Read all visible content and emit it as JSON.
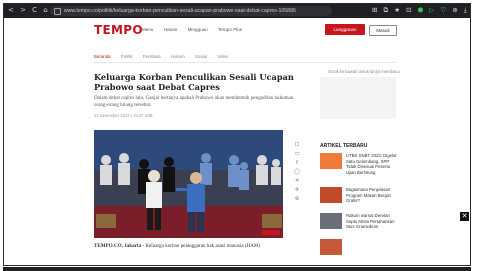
{
  "browser": {
    "nav_icons": "< > C ⌂",
    "url": "www.tempo.co/politik/keluarga-korban-penculikan-sesali-ucapan-prabowe-saat-debat-capres-105886",
    "ext_icons": "⊞ ⧉ ★ ⊡",
    "ext_green": "⬢ ▷",
    "ext_tail": "♡ ⊕ ⤓ ≡"
  },
  "site": {
    "logo": "TEMPO",
    "nav": [
      "Menu",
      "Harian",
      "Mingguan",
      "Tempo Plus"
    ],
    "subscribe": "Langganan",
    "login": "Masuk",
    "subnav": [
      "Beranda",
      "Politik",
      "Peristiwa",
      "Hukum",
      "Sosial",
      "Video"
    ]
  },
  "article": {
    "title": "Keluarga Korban Penculikan Sesali Ucapan Prabowo saat Debat Capres",
    "lead": "Dalam debat capres lalu, Ganjar bertanya apakah Prabowo akan membentuk pengadilan hukuman orang-orang hilang tersebut.",
    "date": "13 Desember 2023 | 15:47 WIB",
    "body_prefix": "TEMPO.CO, Jakarta",
    "body_rest": " - Keluarga korban pelanggaran hak asasi manusia (HAM)"
  },
  "sidebar": {
    "ad_line": "Scroll ke bawah untuk lanjut membaca",
    "heading": "ARTIKEL TERBARU",
    "items": [
      {
        "text": "UTBK SNBT 2023: Digelar Satu Gelombang, SPP Tidak Disesuai Peserta Ujian Berhitung",
        "color": "#f07a3a"
      },
      {
        "text": "Bagaimana Penjelasan Program Makan Bergizi Gratis?",
        "color": "#c04a2a"
      },
      {
        "text": "Rakum warnai Deretan Saptu Minta Pertahankan Stus Gramedium",
        "color": "#6b6f7a"
      },
      {
        "text": "Kampanye Akbar Terakhir Paslon",
        "color": "#c45a3a"
      }
    ]
  },
  "share_icons": [
    "☐",
    "▭",
    "f",
    "◯",
    "✕",
    "✈",
    "⊛"
  ],
  "close_label": "✕",
  "colors": {
    "brand": "#c4161c",
    "browser_bar": "#1f2023"
  }
}
